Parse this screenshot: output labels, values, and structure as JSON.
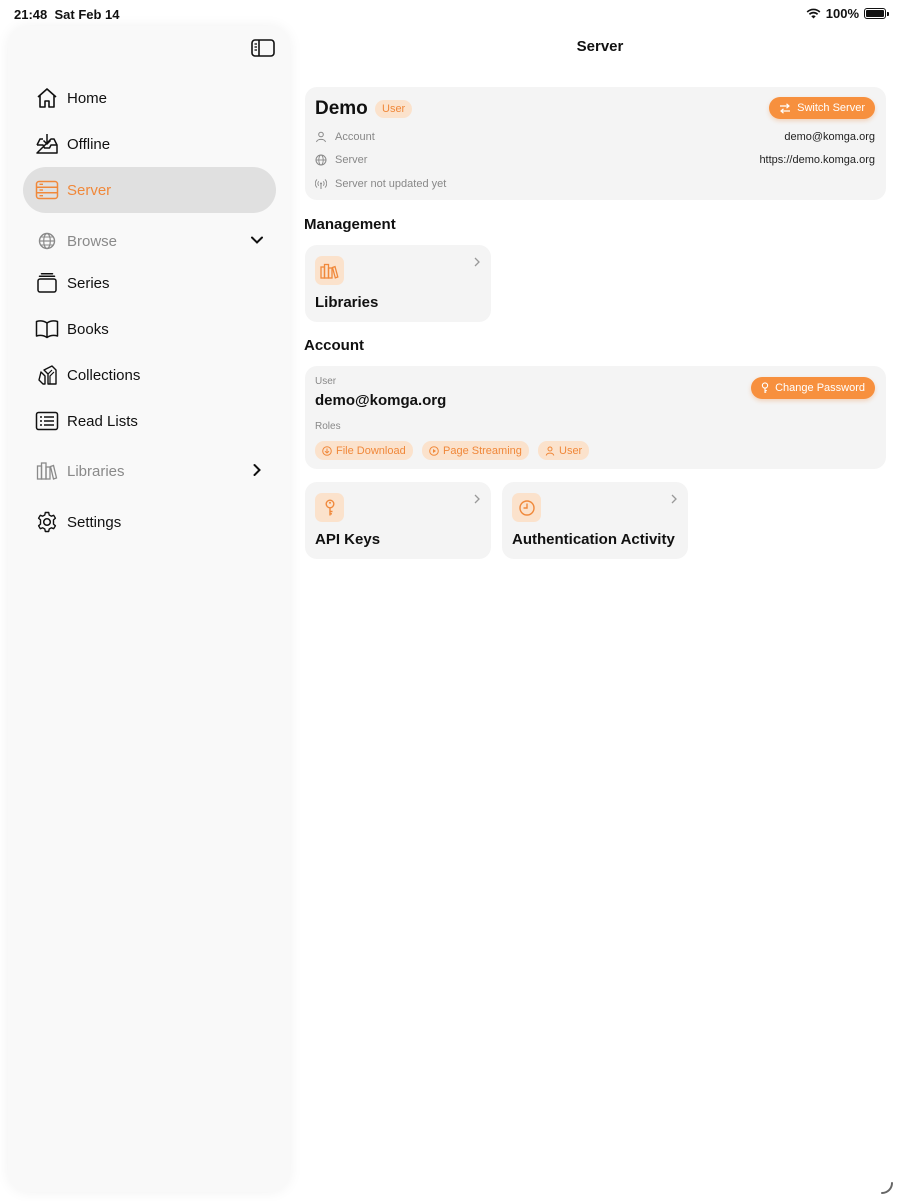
{
  "status_bar": {
    "time": "21:48",
    "date": "Sat Feb 14",
    "battery": "100%"
  },
  "sidebar": {
    "items": [
      {
        "label": "Home",
        "icon": "house-icon"
      },
      {
        "label": "Offline",
        "icon": "tray-download-icon"
      },
      {
        "label": "Server",
        "icon": "server-rack-icon",
        "active": true
      },
      {
        "label": "Browse",
        "icon": "globe-icon",
        "section": true,
        "expanded": true
      },
      {
        "label": "Series",
        "icon": "stack-icon"
      },
      {
        "label": "Books",
        "icon": "book-open-icon"
      },
      {
        "label": "Collections",
        "icon": "collections-icon"
      },
      {
        "label": "Read Lists",
        "icon": "list-icon"
      },
      {
        "label": "Libraries",
        "icon": "books-shelf-icon",
        "section": true,
        "expanded": false
      },
      {
        "label": "Settings",
        "icon": "gear-icon"
      }
    ]
  },
  "main": {
    "title": "Server",
    "server": {
      "name": "Demo",
      "role_badge": "User",
      "switch_button": "Switch Server",
      "account_label": "Account",
      "account_value": "demo@komga.org",
      "server_label": "Server",
      "server_value": "https://demo.komga.org",
      "status_text": "Server not updated yet"
    },
    "management": {
      "title": "Management",
      "tiles": [
        {
          "label": "Libraries",
          "icon": "books-shelf-icon"
        }
      ]
    },
    "account": {
      "title": "Account",
      "user_label": "User",
      "user_email": "demo@komga.org",
      "change_password": "Change Password",
      "roles_label": "Roles",
      "roles": [
        "File Download",
        "Page Streaming",
        "User"
      ],
      "tiles": [
        {
          "label": "API Keys",
          "icon": "key-icon"
        },
        {
          "label": "Authentication Activity",
          "icon": "clock-icon"
        }
      ]
    }
  },
  "colors": {
    "accent": "#f0883a",
    "accent_light": "#fbe2cc",
    "card": "#f4f4f4"
  }
}
